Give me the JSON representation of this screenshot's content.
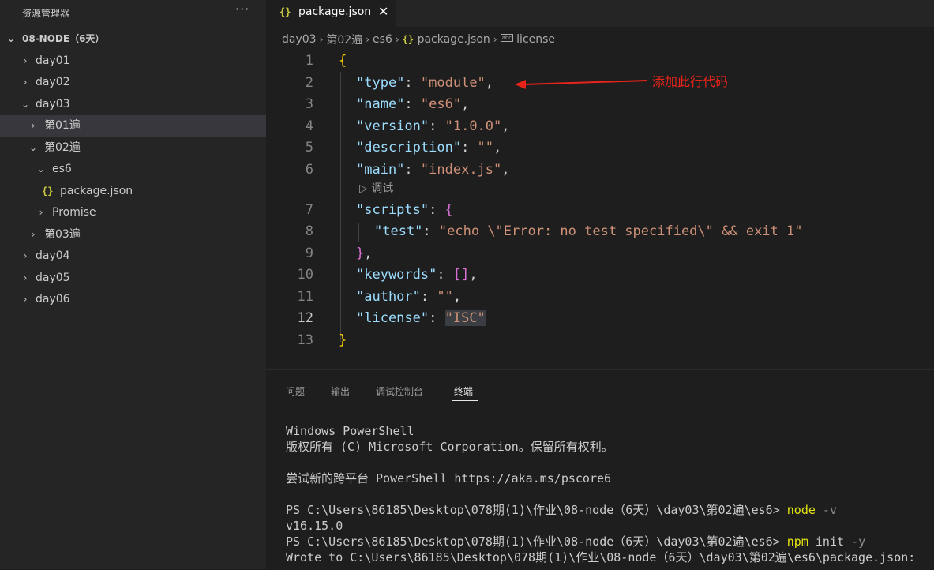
{
  "sidebar": {
    "title": "资源管理器",
    "more": "···",
    "root_label": "08-NODE（6天）",
    "items": [
      {
        "label": "day01"
      },
      {
        "label": "day02"
      },
      {
        "label": "day03"
      },
      {
        "label": "第01遍"
      },
      {
        "label": "第02遍"
      },
      {
        "label": "es6"
      },
      {
        "label": "package.json"
      },
      {
        "label": "Promise"
      },
      {
        "label": "第03遍"
      },
      {
        "label": "day04"
      },
      {
        "label": "day05"
      },
      {
        "label": "day06"
      }
    ]
  },
  "tab": {
    "icon": "{}",
    "label": "package.json",
    "close": "✕"
  },
  "breadcrumb": {
    "parts": [
      "day03",
      "第02遍",
      "es6",
      "package.json",
      "license"
    ],
    "json_icon": "{}",
    "license_icon": "abc"
  },
  "editor": {
    "line_numbers": [
      "1",
      "2",
      "3",
      "4",
      "5",
      "6",
      "7",
      "8",
      "9",
      "10",
      "11",
      "12",
      "13"
    ],
    "active_line": "12",
    "codelens": "▷ 调试",
    "lines": {
      "l1_open": "{",
      "type_key": "\"type\"",
      "type_val": "\"module\"",
      "name_key": "\"name\"",
      "name_val": "\"es6\"",
      "version_key": "\"version\"",
      "version_val": "\"1.0.0\"",
      "description_key": "\"description\"",
      "description_val": "\"\"",
      "main_key": "\"main\"",
      "main_val": "\"index.js\"",
      "scripts_key": "\"scripts\"",
      "scripts_open": "{",
      "test_key": "\"test\"",
      "test_val": "\"echo \\\"Error: no test specified\\\" && exit 1\"",
      "scripts_close": "}",
      "keywords_key": "\"keywords\"",
      "keywords_val": "[]",
      "author_key": "\"author\"",
      "author_val": "\"\"",
      "license_key": "\"license\"",
      "license_val": "\"ISC\"",
      "l13_close": "}"
    }
  },
  "annotation": {
    "text": "添加此行代码",
    "color": "#e8241a"
  },
  "panel": {
    "tabs": [
      "问题",
      "输出",
      "调试控制台",
      "终端"
    ],
    "active_tab": "终端"
  },
  "terminal": {
    "line1": "Windows PowerShell",
    "line2": "版权所有 (C) Microsoft Corporation。保留所有权利。",
    "line3": "尝试新的跨平台 PowerShell https://aka.ms/pscore6",
    "prompt1": "PS C:\\Users\\86185\\Desktop\\078期(1)\\作业\\08-node（6天）\\day03\\第02遍\\es6> ",
    "cmd1": "node",
    "arg1": " -v",
    "out1": "v16.15.0",
    "prompt2": "PS C:\\Users\\86185\\Desktop\\078期(1)\\作业\\08-node（6天）\\day03\\第02遍\\es6> ",
    "cmd2": "npm",
    "arg2a": " init",
    "arg2b": " -y",
    "out2": "Wrote to C:\\Users\\86185\\Desktop\\078期(1)\\作业\\08-node（6天）\\day03\\第02遍\\es6\\package.json:"
  }
}
